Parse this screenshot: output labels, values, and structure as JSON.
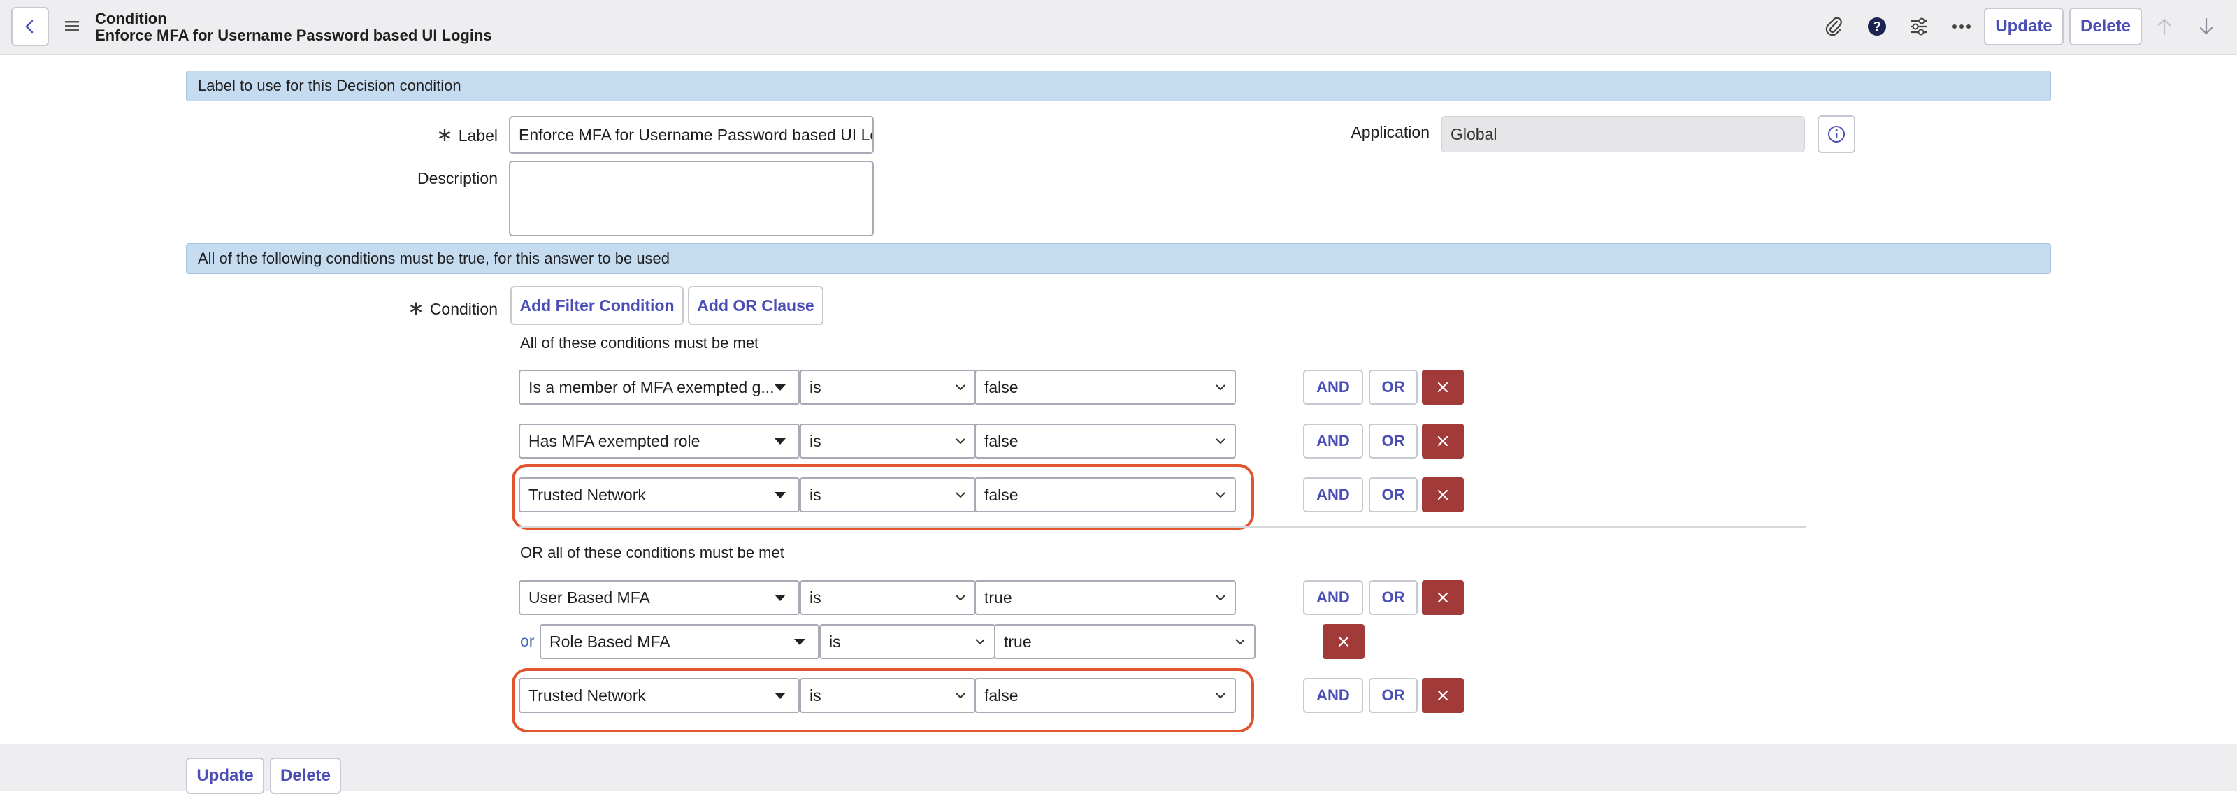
{
  "header": {
    "title": "Condition",
    "subtitle": "Enforce MFA for Username Password based UI Logins",
    "update_label": "Update",
    "delete_label": "Delete"
  },
  "section1": {
    "banner": "Label to use for this Decision condition",
    "label_label": "Label",
    "label_value": "Enforce MFA for Username Password based UI Lo",
    "description_label": "Description",
    "description_value": "",
    "application_label": "Application",
    "application_value": "Global"
  },
  "section2": {
    "banner": "All of the following conditions must be true, for this answer to be used",
    "condition_label": "Condition",
    "add_filter_label": "Add Filter Condition",
    "add_or_label": "Add OR Clause"
  },
  "condition_groups": [
    {
      "heading": "All of these conditions must be met",
      "rows": [
        {
          "field": "Is a member of MFA exempted g...",
          "operator": "is",
          "value": "false"
        },
        {
          "field": "Has MFA exempted role",
          "operator": "is",
          "value": "false"
        },
        {
          "field": "Trusted Network",
          "operator": "is",
          "value": "false"
        }
      ]
    },
    {
      "heading": "OR all of these conditions must be met",
      "rows": [
        {
          "field": "User Based MFA",
          "operator": "is",
          "value": "true"
        },
        {
          "prefix": "or",
          "field": "Role Based MFA",
          "operator": "is",
          "value": "true"
        },
        {
          "field": "Trusted Network",
          "operator": "is",
          "value": "false"
        }
      ]
    }
  ],
  "row_buttons": {
    "and": "AND",
    "or": "OR"
  },
  "footer": {
    "update_label": "Update",
    "delete_label": "Delete"
  },
  "colors": {
    "accent": "#4b4fb5",
    "banner": "#c5dbf0",
    "delete_red": "#a33a3a",
    "highlight": "#e0552f"
  }
}
